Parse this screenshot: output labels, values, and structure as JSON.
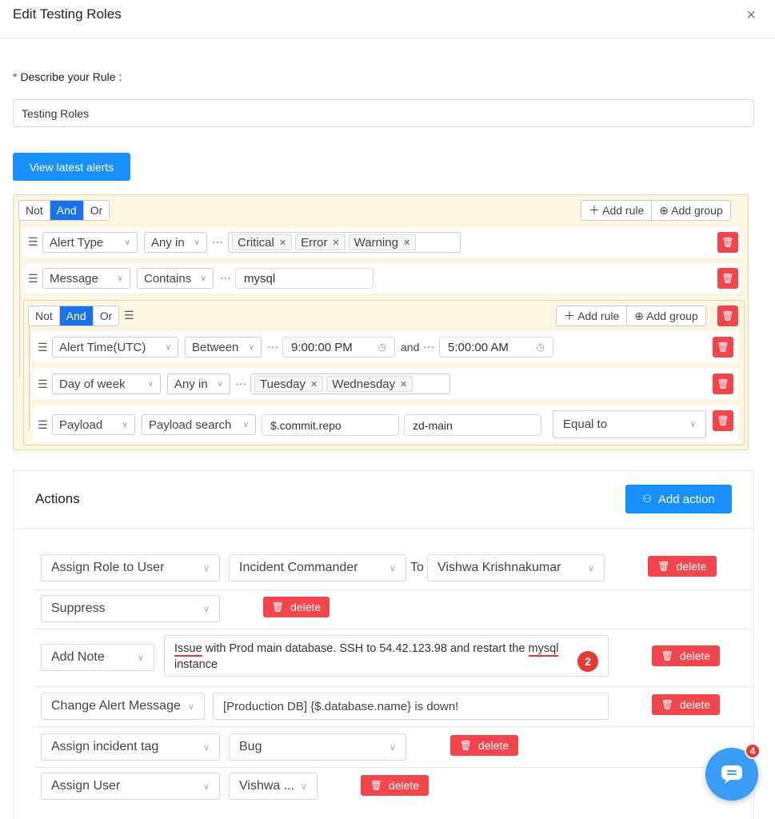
{
  "header": {
    "title": "Edit Testing Roles",
    "close": "×"
  },
  "rule_form": {
    "label": "Describe your Rule :",
    "required_mark": "*",
    "value": "Testing Roles",
    "view_alerts_button": "View latest alerts"
  },
  "query": {
    "outer": {
      "combinator": [
        "Not",
        "And",
        "Or"
      ],
      "active": "And",
      "add_rule": "Add rule",
      "add_group": "Add group",
      "rules": [
        {
          "field": "Alert Type",
          "operator": "Any in",
          "tags": [
            "Critical",
            "Error",
            "Warning"
          ]
        },
        {
          "field": "Message",
          "operator": "Contains",
          "value": "mysql"
        }
      ]
    },
    "inner": {
      "combinator": [
        "Not",
        "And",
        "Or"
      ],
      "active": "And",
      "add_rule": "Add rule",
      "add_group": "Add group",
      "rules": [
        {
          "field": "Alert Time(UTC)",
          "operator": "Between",
          "from": "9:00:00 PM",
          "joiner": "and",
          "to": "5:00:00 AM"
        },
        {
          "field": "Day of week",
          "operator": "Any in",
          "tags": [
            "Tuesday",
            "Wednesday"
          ]
        },
        {
          "field": "Payload",
          "operator": "Payload search",
          "path": "$.commit.repo",
          "value": "zd-main",
          "comparator": "Equal to"
        }
      ]
    },
    "ellipsis": "···"
  },
  "actions": {
    "title": "Actions",
    "add_action": "Add action",
    "delete_label": "delete",
    "rows": [
      {
        "type": "Assign Role to User",
        "role": "Incident Commander",
        "to": "To",
        "user": "Vishwa Krishnakumar"
      },
      {
        "type": "Suppress"
      },
      {
        "type": "Add Note",
        "note_pre": "Issue",
        "note_mid": " with Prod main database. SSH to 54.42.123.98 and restart the ",
        "note_sq": "mysql",
        "note_post": " instance",
        "badge": "2"
      },
      {
        "type": "Change Alert Message",
        "message": "[Production DB] {$.database.name} is down!"
      },
      {
        "type": "Assign incident tag",
        "tag": "Bug"
      },
      {
        "type": "Assign User",
        "user": "Vishwa ..."
      }
    ]
  },
  "chat": {
    "badge": "4"
  }
}
